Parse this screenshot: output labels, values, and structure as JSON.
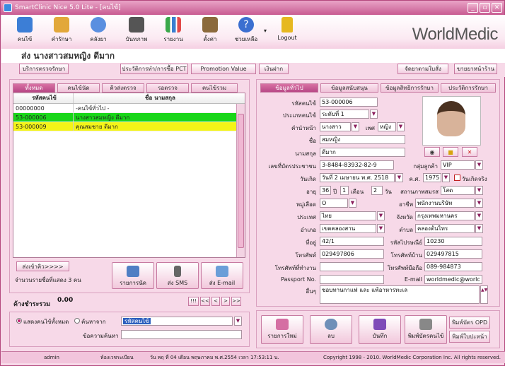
{
  "window": {
    "title": "SmartClinic Nice 5.0 Lite - [คนไข้]",
    "minimize": "_",
    "restore": "▫",
    "close": "✕"
  },
  "toolbar": {
    "items": [
      {
        "label": "คนไข้",
        "icon": "patient-icon",
        "color": "#3c7ed6"
      },
      {
        "label": "คำรักษา",
        "icon": "money-icon",
        "color": "#e2a83a"
      },
      {
        "label": "คลังยา",
        "icon": "capsule-icon",
        "color": "#5a8fe0"
      },
      {
        "label": "บันทภาพ",
        "icon": "camera-icon",
        "color": "#555555"
      },
      {
        "label": "รายงาน",
        "icon": "chart-icon",
        "color": "#3aa84a"
      },
      {
        "label": "ตั้งค่า",
        "icon": "tools-icon",
        "color": "#8b6a3c"
      },
      {
        "label": "ช่วยเหลือ",
        "icon": "help-icon",
        "color": "#3b6fd0"
      },
      {
        "label": "Logout",
        "icon": "lock-icon",
        "color": "#e6b820"
      }
    ],
    "logo": "WorldMedic"
  },
  "patient": {
    "name": "ส่ง  นางสาวสมหญิง ดีมาก"
  },
  "actions": {
    "service": "บริการตรวจรักษา",
    "history": "ประวัติการทำ/การซื้อ PCT",
    "promotion": "Promotion Value",
    "deposit": "เงินฝาก",
    "appointment": "จัดยาตามใบสั่ง",
    "sell": "ขายยาหน้าร้าน"
  },
  "left_tabs": [
    "ทั้งหมด",
    "คนไข้นัด",
    "คิวส่งตรวจ",
    "รอตรวจ",
    "คนไข้รวม"
  ],
  "grid": {
    "columns": [
      "รหัสคนไข้",
      "ชื่อ นามสกุล"
    ],
    "rows": [
      {
        "id": "00000000",
        "name": "-คนไข้ทั่วไป -",
        "color": "#ffffff"
      },
      {
        "id": "53-000006",
        "name": "นางสาวสมหญิง ดีมาก",
        "color": "#19d619"
      },
      {
        "id": "53-000009",
        "name": "คุณสมชาย ดีมาก",
        "color": "#f4f417"
      }
    ]
  },
  "left_bottom": {
    "queue_button": "ส่งเข้าคิว>>>>",
    "count_text": "จำนวนรายชื่อที่แสดง 3 คน",
    "appt_button": "รายการนัด",
    "sms_button": "ส่ง SMS",
    "email_button": "ส่ง E-mail",
    "balance_label": "ค้างชำระรวม",
    "balance_value": "0.00",
    "nav": [
      "!!!",
      "<<",
      "<",
      ">",
      ">>"
    ],
    "show_all": "แสดงคนไข้ทั้งหมด",
    "search_from": "ค้นหาจาก",
    "search_field": "รหัสคนไข้",
    "search_text_label": "ข้อความค้นหา",
    "search_text": ""
  },
  "right_tabs": [
    "ข้อมูลทั่วไป",
    "ข้อมูลสนับสนุน",
    "ข้อมูลสิทธิการรักษา",
    "ประวัติการรักษา"
  ],
  "form": {
    "code_label": "รหัสคนไข้",
    "code": "53-000006",
    "type_label": "ประเภทคนไข้",
    "type": "ระดับที่ 1",
    "prefix_label": "คำนำหน้า",
    "prefix": "นางสาว",
    "sex_label": "เพศ",
    "sex": "หญิง",
    "name_label": "ชื่อ",
    "name": "สมหญิง",
    "surname_label": "นามสกุล",
    "surname": "ดีมาก",
    "idcard_label": "เลขที่บัตรประชาชน",
    "idcard": "3-8484-83932-82-9",
    "group_label": "กลุ่มลูกค้า",
    "group": "VIP",
    "dob_label": "วันเกิด",
    "dob": "วันที่  2  เมษายน  พ.ศ. 2518",
    "ad_label": "ค.ศ.",
    "ad": "1975",
    "realdate": "วันเกิดจริง",
    "age_label": "อายุ",
    "age_y": "36",
    "age_y_unit": "ปี",
    "age_m": "1",
    "age_m_unit": "เดือน",
    "age_d": "2",
    "age_d_unit": "วัน",
    "marital_label": "สถานภาพสมรส",
    "marital": "โสด",
    "blood_label": "หมู่เลือด",
    "blood": "O",
    "job_label": "อาชีพ",
    "job": "พนักงานบริษัท",
    "country_label": "ประเทศ",
    "country": "ไทย",
    "province_label": "จังหวัด",
    "province": "กรุงเทพมหานคร",
    "district_label": "อำเภอ",
    "district": "เขตคลองสาน",
    "subdistrict_label": "ตำบล",
    "subdistrict": "คลองต้นไทร",
    "address_label": "ที่อยู่",
    "address": "42/1",
    "zip_label": "รหัสไปรษณีย์",
    "zip": "10230",
    "phone_label": "โทรศัพท์",
    "phone": "029497806",
    "homephone_label": "โทรศัพท์บ้าน",
    "homephone": "029497815",
    "workphone_label": "โทรศัพท์ที่ทำงาน",
    "workphone": "",
    "mobile_label": "โทรศัพท์มือถือ",
    "mobile": "089-984873",
    "passport_label": "Passport No.",
    "passport": "",
    "email_label": "E-mail",
    "email": "worldmedic@worlc",
    "other_label": "อื่นๆ",
    "other": "ชอบทานกาแฟ และ แพ้อาหารทะเล"
  },
  "right_bottom": {
    "new": "รายการใหม่",
    "delete": "ลบ",
    "save": "บันทึก",
    "print_card": "พิมพ์บัตรคนไข้",
    "print_opd": "พิมพ์บัตร OPD",
    "print_front": "พิมพ์ใบปะหน้า"
  },
  "status": {
    "user": "admin",
    "room": "ห้องเวชระเบียน",
    "datetime": "วัน พฤ ที่ 04 เดือน พฤษภาคม พ.ศ.2554 เวลา 17:53:11 น.",
    "copyright": "Copyright 1998 - 2010. WorldMedic Corporation Inc. All rights reserved."
  }
}
